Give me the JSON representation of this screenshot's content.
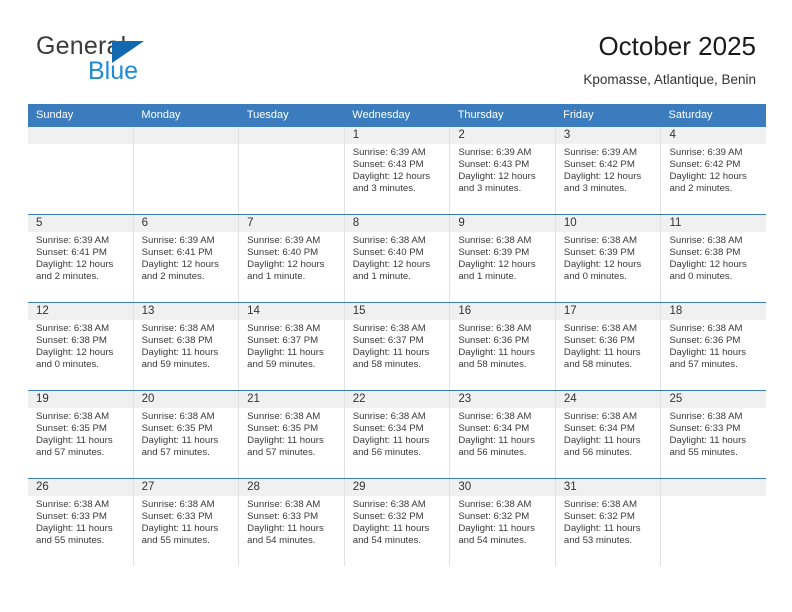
{
  "brand": {
    "line1": "General",
    "line2": "Blue",
    "triangle_color": "#1269b0",
    "line2_color": "#1f8ad6"
  },
  "header": {
    "title": "October 2025",
    "subtitle": "Kpomasse, Atlantique, Benin"
  },
  "theme": {
    "header_blue": "#3a7cbe",
    "daynum_bg": "#f0f0f0",
    "text": "#333333"
  },
  "weekdays": [
    "Sunday",
    "Monday",
    "Tuesday",
    "Wednesday",
    "Thursday",
    "Friday",
    "Saturday"
  ],
  "weeks": [
    [
      {
        "day": "",
        "sunrise": "",
        "sunset": "",
        "daylight": "",
        "empty": true
      },
      {
        "day": "",
        "sunrise": "",
        "sunset": "",
        "daylight": "",
        "empty": true
      },
      {
        "day": "",
        "sunrise": "",
        "sunset": "",
        "daylight": "",
        "empty": true
      },
      {
        "day": "1",
        "sunrise": "Sunrise: 6:39 AM",
        "sunset": "Sunset: 6:43 PM",
        "daylight": "Daylight: 12 hours and 3 minutes."
      },
      {
        "day": "2",
        "sunrise": "Sunrise: 6:39 AM",
        "sunset": "Sunset: 6:43 PM",
        "daylight": "Daylight: 12 hours and 3 minutes."
      },
      {
        "day": "3",
        "sunrise": "Sunrise: 6:39 AM",
        "sunset": "Sunset: 6:42 PM",
        "daylight": "Daylight: 12 hours and 3 minutes."
      },
      {
        "day": "4",
        "sunrise": "Sunrise: 6:39 AM",
        "sunset": "Sunset: 6:42 PM",
        "daylight": "Daylight: 12 hours and 2 minutes."
      }
    ],
    [
      {
        "day": "5",
        "sunrise": "Sunrise: 6:39 AM",
        "sunset": "Sunset: 6:41 PM",
        "daylight": "Daylight: 12 hours and 2 minutes."
      },
      {
        "day": "6",
        "sunrise": "Sunrise: 6:39 AM",
        "sunset": "Sunset: 6:41 PM",
        "daylight": "Daylight: 12 hours and 2 minutes."
      },
      {
        "day": "7",
        "sunrise": "Sunrise: 6:39 AM",
        "sunset": "Sunset: 6:40 PM",
        "daylight": "Daylight: 12 hours and 1 minute."
      },
      {
        "day": "8",
        "sunrise": "Sunrise: 6:38 AM",
        "sunset": "Sunset: 6:40 PM",
        "daylight": "Daylight: 12 hours and 1 minute."
      },
      {
        "day": "9",
        "sunrise": "Sunrise: 6:38 AM",
        "sunset": "Sunset: 6:39 PM",
        "daylight": "Daylight: 12 hours and 1 minute."
      },
      {
        "day": "10",
        "sunrise": "Sunrise: 6:38 AM",
        "sunset": "Sunset: 6:39 PM",
        "daylight": "Daylight: 12 hours and 0 minutes."
      },
      {
        "day": "11",
        "sunrise": "Sunrise: 6:38 AM",
        "sunset": "Sunset: 6:38 PM",
        "daylight": "Daylight: 12 hours and 0 minutes."
      }
    ],
    [
      {
        "day": "12",
        "sunrise": "Sunrise: 6:38 AM",
        "sunset": "Sunset: 6:38 PM",
        "daylight": "Daylight: 12 hours and 0 minutes."
      },
      {
        "day": "13",
        "sunrise": "Sunrise: 6:38 AM",
        "sunset": "Sunset: 6:38 PM",
        "daylight": "Daylight: 11 hours and 59 minutes."
      },
      {
        "day": "14",
        "sunrise": "Sunrise: 6:38 AM",
        "sunset": "Sunset: 6:37 PM",
        "daylight": "Daylight: 11 hours and 59 minutes."
      },
      {
        "day": "15",
        "sunrise": "Sunrise: 6:38 AM",
        "sunset": "Sunset: 6:37 PM",
        "daylight": "Daylight: 11 hours and 58 minutes."
      },
      {
        "day": "16",
        "sunrise": "Sunrise: 6:38 AM",
        "sunset": "Sunset: 6:36 PM",
        "daylight": "Daylight: 11 hours and 58 minutes."
      },
      {
        "day": "17",
        "sunrise": "Sunrise: 6:38 AM",
        "sunset": "Sunset: 6:36 PM",
        "daylight": "Daylight: 11 hours and 58 minutes."
      },
      {
        "day": "18",
        "sunrise": "Sunrise: 6:38 AM",
        "sunset": "Sunset: 6:36 PM",
        "daylight": "Daylight: 11 hours and 57 minutes."
      }
    ],
    [
      {
        "day": "19",
        "sunrise": "Sunrise: 6:38 AM",
        "sunset": "Sunset: 6:35 PM",
        "daylight": "Daylight: 11 hours and 57 minutes."
      },
      {
        "day": "20",
        "sunrise": "Sunrise: 6:38 AM",
        "sunset": "Sunset: 6:35 PM",
        "daylight": "Daylight: 11 hours and 57 minutes."
      },
      {
        "day": "21",
        "sunrise": "Sunrise: 6:38 AM",
        "sunset": "Sunset: 6:35 PM",
        "daylight": "Daylight: 11 hours and 57 minutes."
      },
      {
        "day": "22",
        "sunrise": "Sunrise: 6:38 AM",
        "sunset": "Sunset: 6:34 PM",
        "daylight": "Daylight: 11 hours and 56 minutes."
      },
      {
        "day": "23",
        "sunrise": "Sunrise: 6:38 AM",
        "sunset": "Sunset: 6:34 PM",
        "daylight": "Daylight: 11 hours and 56 minutes."
      },
      {
        "day": "24",
        "sunrise": "Sunrise: 6:38 AM",
        "sunset": "Sunset: 6:34 PM",
        "daylight": "Daylight: 11 hours and 56 minutes."
      },
      {
        "day": "25",
        "sunrise": "Sunrise: 6:38 AM",
        "sunset": "Sunset: 6:33 PM",
        "daylight": "Daylight: 11 hours and 55 minutes."
      }
    ],
    [
      {
        "day": "26",
        "sunrise": "Sunrise: 6:38 AM",
        "sunset": "Sunset: 6:33 PM",
        "daylight": "Daylight: 11 hours and 55 minutes."
      },
      {
        "day": "27",
        "sunrise": "Sunrise: 6:38 AM",
        "sunset": "Sunset: 6:33 PM",
        "daylight": "Daylight: 11 hours and 55 minutes."
      },
      {
        "day": "28",
        "sunrise": "Sunrise: 6:38 AM",
        "sunset": "Sunset: 6:33 PM",
        "daylight": "Daylight: 11 hours and 54 minutes."
      },
      {
        "day": "29",
        "sunrise": "Sunrise: 6:38 AM",
        "sunset": "Sunset: 6:32 PM",
        "daylight": "Daylight: 11 hours and 54 minutes."
      },
      {
        "day": "30",
        "sunrise": "Sunrise: 6:38 AM",
        "sunset": "Sunset: 6:32 PM",
        "daylight": "Daylight: 11 hours and 54 minutes."
      },
      {
        "day": "31",
        "sunrise": "Sunrise: 6:38 AM",
        "sunset": "Sunset: 6:32 PM",
        "daylight": "Daylight: 11 hours and 53 minutes."
      },
      {
        "day": "",
        "sunrise": "",
        "sunset": "",
        "daylight": "",
        "empty": true
      }
    ]
  ]
}
